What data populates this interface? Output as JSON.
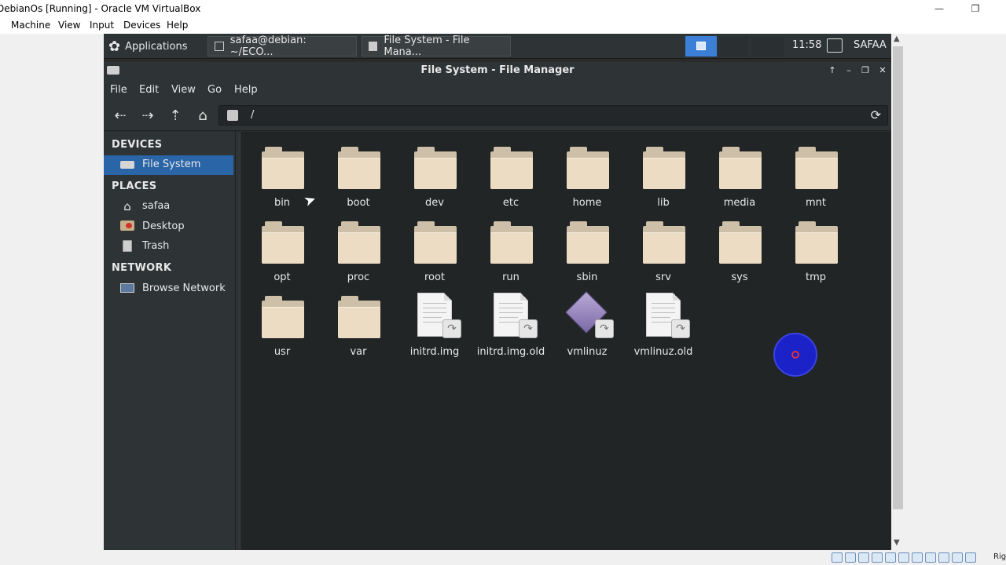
{
  "host": {
    "title": "DebianOs [Running] - Oracle VM VirtualBox",
    "menu": [
      "Machine",
      "View",
      "Input",
      "Devices",
      "Help"
    ],
    "status_right": "Rig"
  },
  "panel": {
    "applications": "Applications",
    "task1": "safaa@debian: ~/ECO...",
    "task2": "File System - File Mana...",
    "clock": "11:58",
    "user": "SAFAA"
  },
  "window": {
    "title": "File System - File Manager",
    "menu": [
      "File",
      "Edit",
      "View",
      "Go",
      "Help"
    ],
    "location": "/"
  },
  "sidebar": {
    "devices_header": "DEVICES",
    "places_header": "PLACES",
    "network_header": "NETWORK",
    "devices": [
      {
        "label": "File System",
        "icon": "drive-icon"
      }
    ],
    "places": [
      {
        "label": "safaa",
        "icon": "home-icon"
      },
      {
        "label": "Desktop",
        "icon": "desktop-icon"
      },
      {
        "label": "Trash",
        "icon": "trash-icon"
      }
    ],
    "network": [
      {
        "label": "Browse Network",
        "icon": "network-icon"
      }
    ]
  },
  "files": [
    {
      "name": "bin",
      "type": "folder"
    },
    {
      "name": "boot",
      "type": "folder"
    },
    {
      "name": "dev",
      "type": "folder"
    },
    {
      "name": "etc",
      "type": "folder"
    },
    {
      "name": "home",
      "type": "folder"
    },
    {
      "name": "lib",
      "type": "folder"
    },
    {
      "name": "media",
      "type": "folder"
    },
    {
      "name": "mnt",
      "type": "folder"
    },
    {
      "name": "opt",
      "type": "folder"
    },
    {
      "name": "proc",
      "type": "folder"
    },
    {
      "name": "root",
      "type": "folder"
    },
    {
      "name": "run",
      "type": "folder"
    },
    {
      "name": "sbin",
      "type": "folder"
    },
    {
      "name": "srv",
      "type": "folder"
    },
    {
      "name": "sys",
      "type": "folder"
    },
    {
      "name": "tmp",
      "type": "folder"
    },
    {
      "name": "usr",
      "type": "folder"
    },
    {
      "name": "var",
      "type": "folder"
    },
    {
      "name": "initrd.img",
      "type": "link-doc"
    },
    {
      "name": "initrd.img.old",
      "type": "link-doc"
    },
    {
      "name": "vmlinuz",
      "type": "link-kernel"
    },
    {
      "name": "vmlinuz.old",
      "type": "link-doc"
    }
  ]
}
